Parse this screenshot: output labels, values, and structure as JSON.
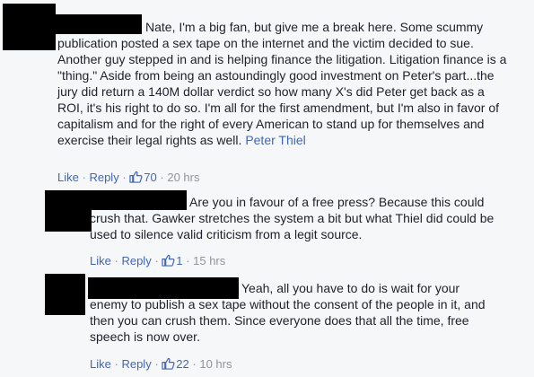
{
  "colors": {
    "background": "#f6f7f9",
    "text": "#1d2129",
    "link": "#4267b2",
    "meta": "#90949c",
    "redaction": "#000000"
  },
  "comments": [
    {
      "lines": [
        "Nate, I'm a big fan, but give me a break here. Some scummy",
        "publication posted a sex tape on the internet and the victim decided to sue.",
        "Another guy stepped in and is helping finance the litigation. Litigation finance is a",
        "\"thing.\" Aside from being an astoundingly good investment on Peter's part...the",
        "jury did return a 140M dollar verdict so how many X's did Peter get back as a",
        "ROI, it's his right to do so. I'm all for the first amendment, but I'm also in favor of",
        "capitalism and for the right of every American to stand up for themselves and",
        "exercise their legal rights as well. "
      ],
      "mention": "Peter Thiel",
      "like_label": "Like",
      "reply_label": "Reply",
      "like_count": "70",
      "time": "20 hrs"
    },
    {
      "lines": [
        "Are you in favour of a free press? Because this could",
        "crush that. Gawker stretches the system a bit but what Thiel did could be",
        "used to silence valid criticism from a legit source."
      ],
      "like_label": "Like",
      "reply_label": "Reply",
      "like_count": "1",
      "time": "15 hrs"
    },
    {
      "lines": [
        "Yeah, all you have to do is wait for your",
        "enemy to publish a sex tape without the consent of the people in it, and",
        "then you can crush them. Since everyone does that all the time, free",
        "speech is now over."
      ],
      "like_label": "Like",
      "reply_label": "Reply",
      "like_count": "22",
      "time": "10 hrs"
    }
  ]
}
